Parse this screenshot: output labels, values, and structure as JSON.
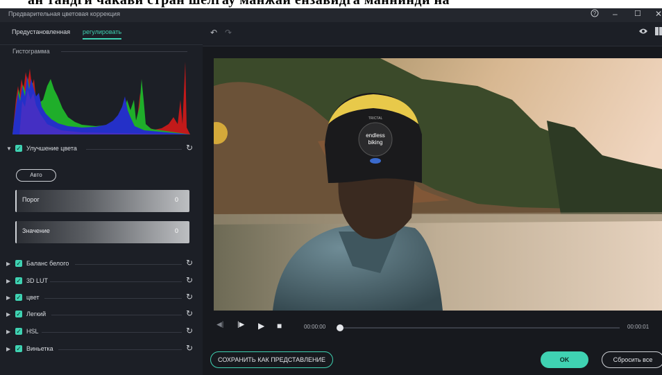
{
  "caption_strip": "ан тандги чакави стран шелгау манжаи ензавидга маннинди на",
  "window": {
    "title": "Предварительная цветовая коррекция",
    "help_icon": "help-circle-icon",
    "minimize_icon": "minimize-icon",
    "maximize_icon": "maximize-icon",
    "close_icon": "close-icon"
  },
  "tabs": {
    "preset": "Предустановленная",
    "adjust": "регулировать"
  },
  "histogram": {
    "title": "Гистограмма"
  },
  "color_enhancement": {
    "label": "Улучшение цвета",
    "auto": "Авто",
    "threshold_label": "Порог",
    "threshold_value": "0",
    "amount_label": "Значение",
    "amount_value": "0"
  },
  "sections": [
    {
      "label": "Баланс белого"
    },
    {
      "label": "3D LUT"
    },
    {
      "label": "цвет"
    },
    {
      "label": "Легкий"
    },
    {
      "label": "HSL"
    },
    {
      "label": "Виньетка"
    }
  ],
  "player": {
    "time_start": "00:00:00",
    "time_end": "00:00:01",
    "helmet_text_1": "endless",
    "helmet_text_2": "biking",
    "helmet_brand": "TRICTAL"
  },
  "buttons": {
    "save_preset": "СОХРАНИТЬ КАК ПРЕДСТАВЛЕНИЕ",
    "ok": "OK",
    "reset_all": "Сбросить все"
  },
  "colors": {
    "accent": "#3fd2b2",
    "panel": "#1c1f26"
  }
}
